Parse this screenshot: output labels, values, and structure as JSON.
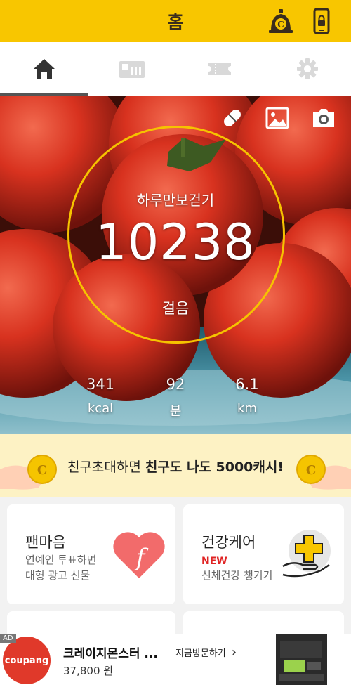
{
  "header": {
    "title": "홈"
  },
  "icons": {
    "header_right": [
      "cash-machine-icon",
      "phone-lock-icon"
    ],
    "tabs": [
      "home-icon",
      "shop-icon",
      "ticket-icon",
      "gear-icon"
    ],
    "hero_tools": [
      "pill-icon",
      "image-icon",
      "camera-icon"
    ]
  },
  "tabs": {
    "active_index": 0
  },
  "pedometer": {
    "goal_label": "하루만보걷기",
    "steps": "10238",
    "steps_unit": "걸음",
    "stats": [
      {
        "value": "341",
        "unit": "kcal"
      },
      {
        "value": "92",
        "unit": "분"
      },
      {
        "value": "6.1",
        "unit": "km"
      }
    ]
  },
  "invite_banner": {
    "text_normal": "친구초대하면 ",
    "text_bold": "친구도 나도 5000캐시!"
  },
  "cards": [
    {
      "title": "팬마음",
      "subtitle_lines": [
        "연예인 투표하면",
        "대형 광고 선물"
      ]
    },
    {
      "title": "건강케어",
      "badge": "NEW",
      "subtitle_lines": [
        "신체건강 챙기기"
      ]
    }
  ],
  "ad": {
    "badge": "AD",
    "brand": "coupang",
    "title": "크레이지몬스터 ...",
    "price": "37,800 원",
    "cta": "지금방문하기"
  },
  "colors": {
    "brand_yellow": "#f8c600",
    "ring": "#f6c300",
    "banner_bg": "#fdf2c4",
    "new_badge": "#e02424",
    "heart": "#f26b6b"
  }
}
